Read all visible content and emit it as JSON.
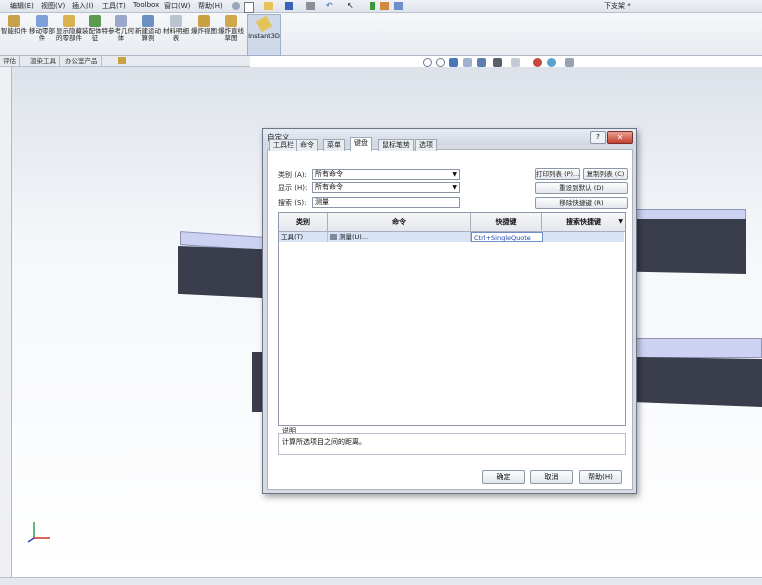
{
  "menubar": {
    "items": [
      "编辑(E)",
      "视图(V)",
      "插入(I)",
      "工具(T)",
      "Toolbox",
      "窗口(W)",
      "帮助(H)"
    ],
    "document_title": "下支架 *"
  },
  "ribbon": {
    "buttons": [
      "智能扣件",
      "移动零部件",
      "显示隐藏的零部件",
      "装配体特征",
      "参考几何体",
      "新建运动算例",
      "材料明细表",
      "爆炸视图",
      "爆炸直线草图",
      "Instant3D"
    ]
  },
  "command_tabs": [
    "评估",
    "渲染工具",
    "办公室产品"
  ],
  "dialog": {
    "title": "自定义",
    "help_label": "?",
    "close_label": "✕",
    "tabs": [
      "工具栏",
      "命令",
      "菜单",
      "键盘",
      "鼠标笔势",
      "选项"
    ],
    "active_tab": "键盘",
    "category_label": "类别 (A):",
    "category_value": "所有命令",
    "show_label": "显示 (H):",
    "show_value": "所有命令",
    "search_label": "搜索 (S):",
    "search_value": "测量",
    "buttons": {
      "print_list": "打印列表 (P)...",
      "copy_list": "复制列表 (C)",
      "reset_default": "重设到默认 (D)",
      "remove_shortcut": "移除快捷键 (R)"
    },
    "table": {
      "headers": [
        "类别",
        "命令",
        "快捷键",
        "搜索快捷键"
      ],
      "rows": [
        {
          "category": "工具(T)",
          "command": "测量(U)...",
          "shortcut": "Ctrl+SingleQuote",
          "search_shortcut": ""
        }
      ]
    },
    "description_label": "说明",
    "description_text": "计算所选项目之间的距离。",
    "ok": "确定",
    "cancel": "取消",
    "help": "帮助(H)"
  },
  "colors": {
    "beam_face": "#3a3d4b",
    "beam_top": "#cdd2f2",
    "selected_row": "#d8e4f6",
    "dialog_frame": "#d6dbe3"
  },
  "icons": [
    "search-icon",
    "zoom-icon",
    "view-orientation-icon",
    "display-style-icon",
    "appearance-icon",
    "scene-icon",
    "triad-icon"
  ]
}
